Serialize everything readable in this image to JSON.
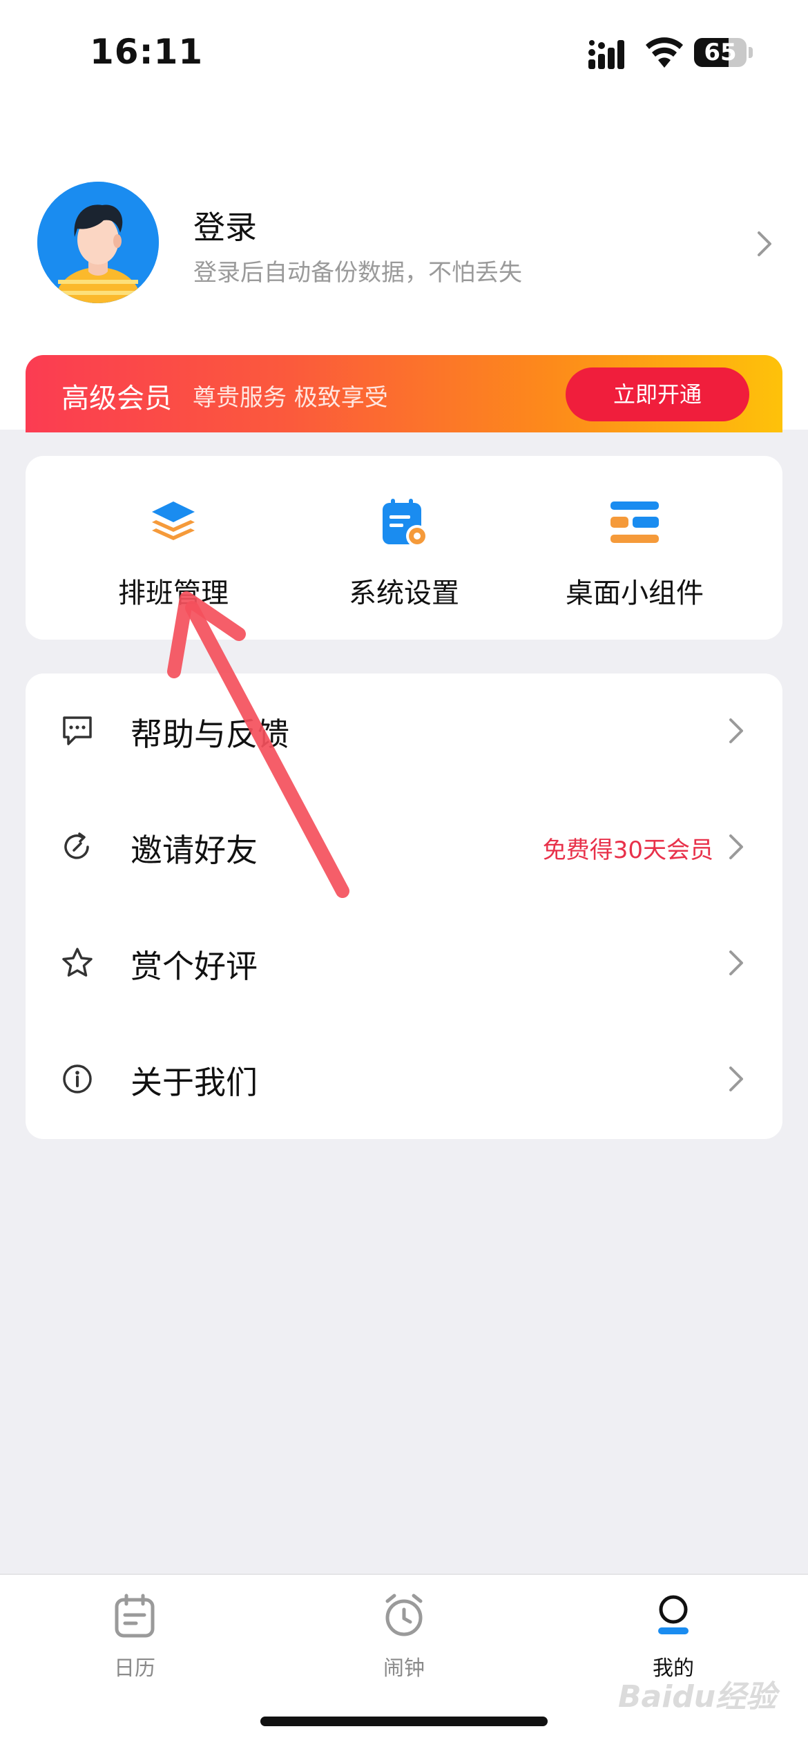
{
  "status_bar": {
    "time": "16:11",
    "battery": "65"
  },
  "profile": {
    "title": "登录",
    "subtitle": "登录后自动备份数据，不怕丢失"
  },
  "vip": {
    "title": "高级会员",
    "slogan": "尊贵服务 极致享受",
    "button": "立即开通"
  },
  "features": [
    {
      "label": "排班管理",
      "icon": "layers-icon"
    },
    {
      "label": "系统设置",
      "icon": "calendar-settings-icon"
    },
    {
      "label": "桌面小组件",
      "icon": "widgets-icon"
    }
  ],
  "menu": [
    {
      "label": "帮助与反馈",
      "icon": "message-icon",
      "extra": ""
    },
    {
      "label": "邀请好友",
      "icon": "refresh-share-icon",
      "extra": "免费得30天会员"
    },
    {
      "label": "赏个好评",
      "icon": "star-icon",
      "extra": ""
    },
    {
      "label": "关于我们",
      "icon": "info-icon",
      "extra": ""
    }
  ],
  "tabs": [
    {
      "label": "日历",
      "icon": "calendar-icon",
      "active": false
    },
    {
      "label": "闹钟",
      "icon": "alarm-clock-icon",
      "active": false
    },
    {
      "label": "我的",
      "icon": "profile-icon",
      "active": true
    }
  ],
  "watermark": "Baidu经验",
  "colors": {
    "vip_gradient_start": "#fb3c52",
    "vip_gradient_end": "#fec20a",
    "vip_button": "#f01e3c",
    "accent_blue": "#1a8cf0",
    "accent_orange": "#fd8b1a",
    "invite_highlight": "#e8314a",
    "annotation_arrow": "#f4505c"
  }
}
